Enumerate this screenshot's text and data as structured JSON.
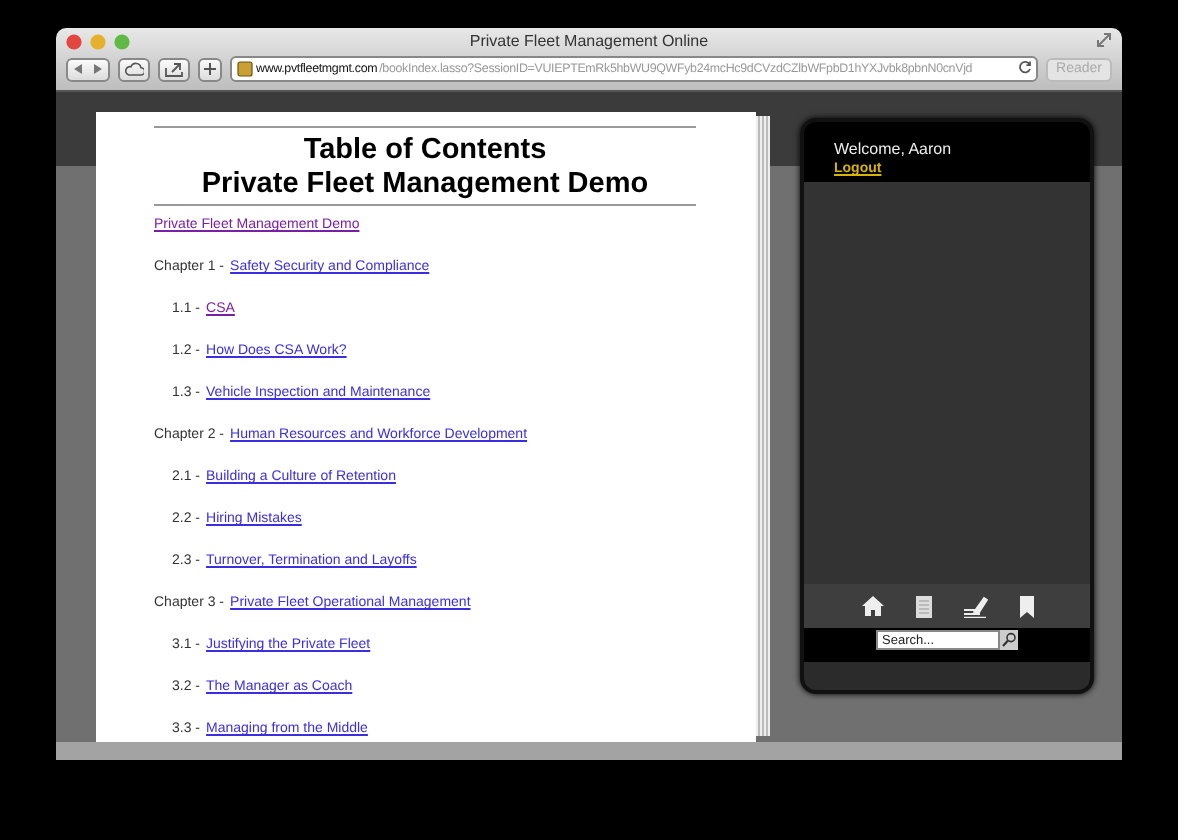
{
  "window": {
    "title": "Private Fleet Management Online"
  },
  "toolbar": {
    "url_domain": "www.pvtfleetmgmt.com",
    "url_path": "/bookIndex.lasso?SessionID=VUIEPTEmRk5hbWU9QWFyb24mcHc9dCVzdCZlbWFpbD1hYXJvbk8pbnN0cnVjd",
    "reader": "Reader"
  },
  "toc": {
    "title": [
      "Table of Contents",
      "Private Fleet Management Demo"
    ],
    "entries": [
      {
        "kind": "top",
        "link": "Private Fleet Management Demo",
        "visited": true
      },
      {
        "kind": "chapter",
        "prefix": "Chapter 1 -",
        "link": "Safety Security and Compliance",
        "visited": false
      },
      {
        "kind": "section",
        "prefix": "1.1 -",
        "link": "CSA",
        "visited": true
      },
      {
        "kind": "section",
        "prefix": "1.2 -",
        "link": "How Does CSA Work?",
        "visited": false
      },
      {
        "kind": "section",
        "prefix": "1.3 -",
        "link": "Vehicle Inspection and Maintenance",
        "visited": false
      },
      {
        "kind": "chapter",
        "prefix": "Chapter 2 -",
        "link": "Human Resources and Workforce Development",
        "visited": false
      },
      {
        "kind": "section",
        "prefix": "2.1 -",
        "link": "Building a Culture of Retention",
        "visited": false
      },
      {
        "kind": "section",
        "prefix": "2.2 -",
        "link": "Hiring Mistakes",
        "visited": false
      },
      {
        "kind": "section",
        "prefix": "2.3 -",
        "link": "Turnover, Termination and Layoffs",
        "visited": false
      },
      {
        "kind": "chapter",
        "prefix": "Chapter 3 -",
        "link": "Private Fleet Operational Management",
        "visited": false
      },
      {
        "kind": "section",
        "prefix": "3.1 -",
        "link": "Justifying the Private Fleet",
        "visited": false
      },
      {
        "kind": "section",
        "prefix": "3.2 -",
        "link": "The Manager as Coach",
        "visited": false
      },
      {
        "kind": "section",
        "prefix": "3.3 -",
        "link": "Managing from the Middle",
        "visited": false
      }
    ]
  },
  "sidebar": {
    "welcome": "Welcome, Aaron",
    "logout": "Logout",
    "search": {
      "placeholder": "Search..."
    }
  }
}
